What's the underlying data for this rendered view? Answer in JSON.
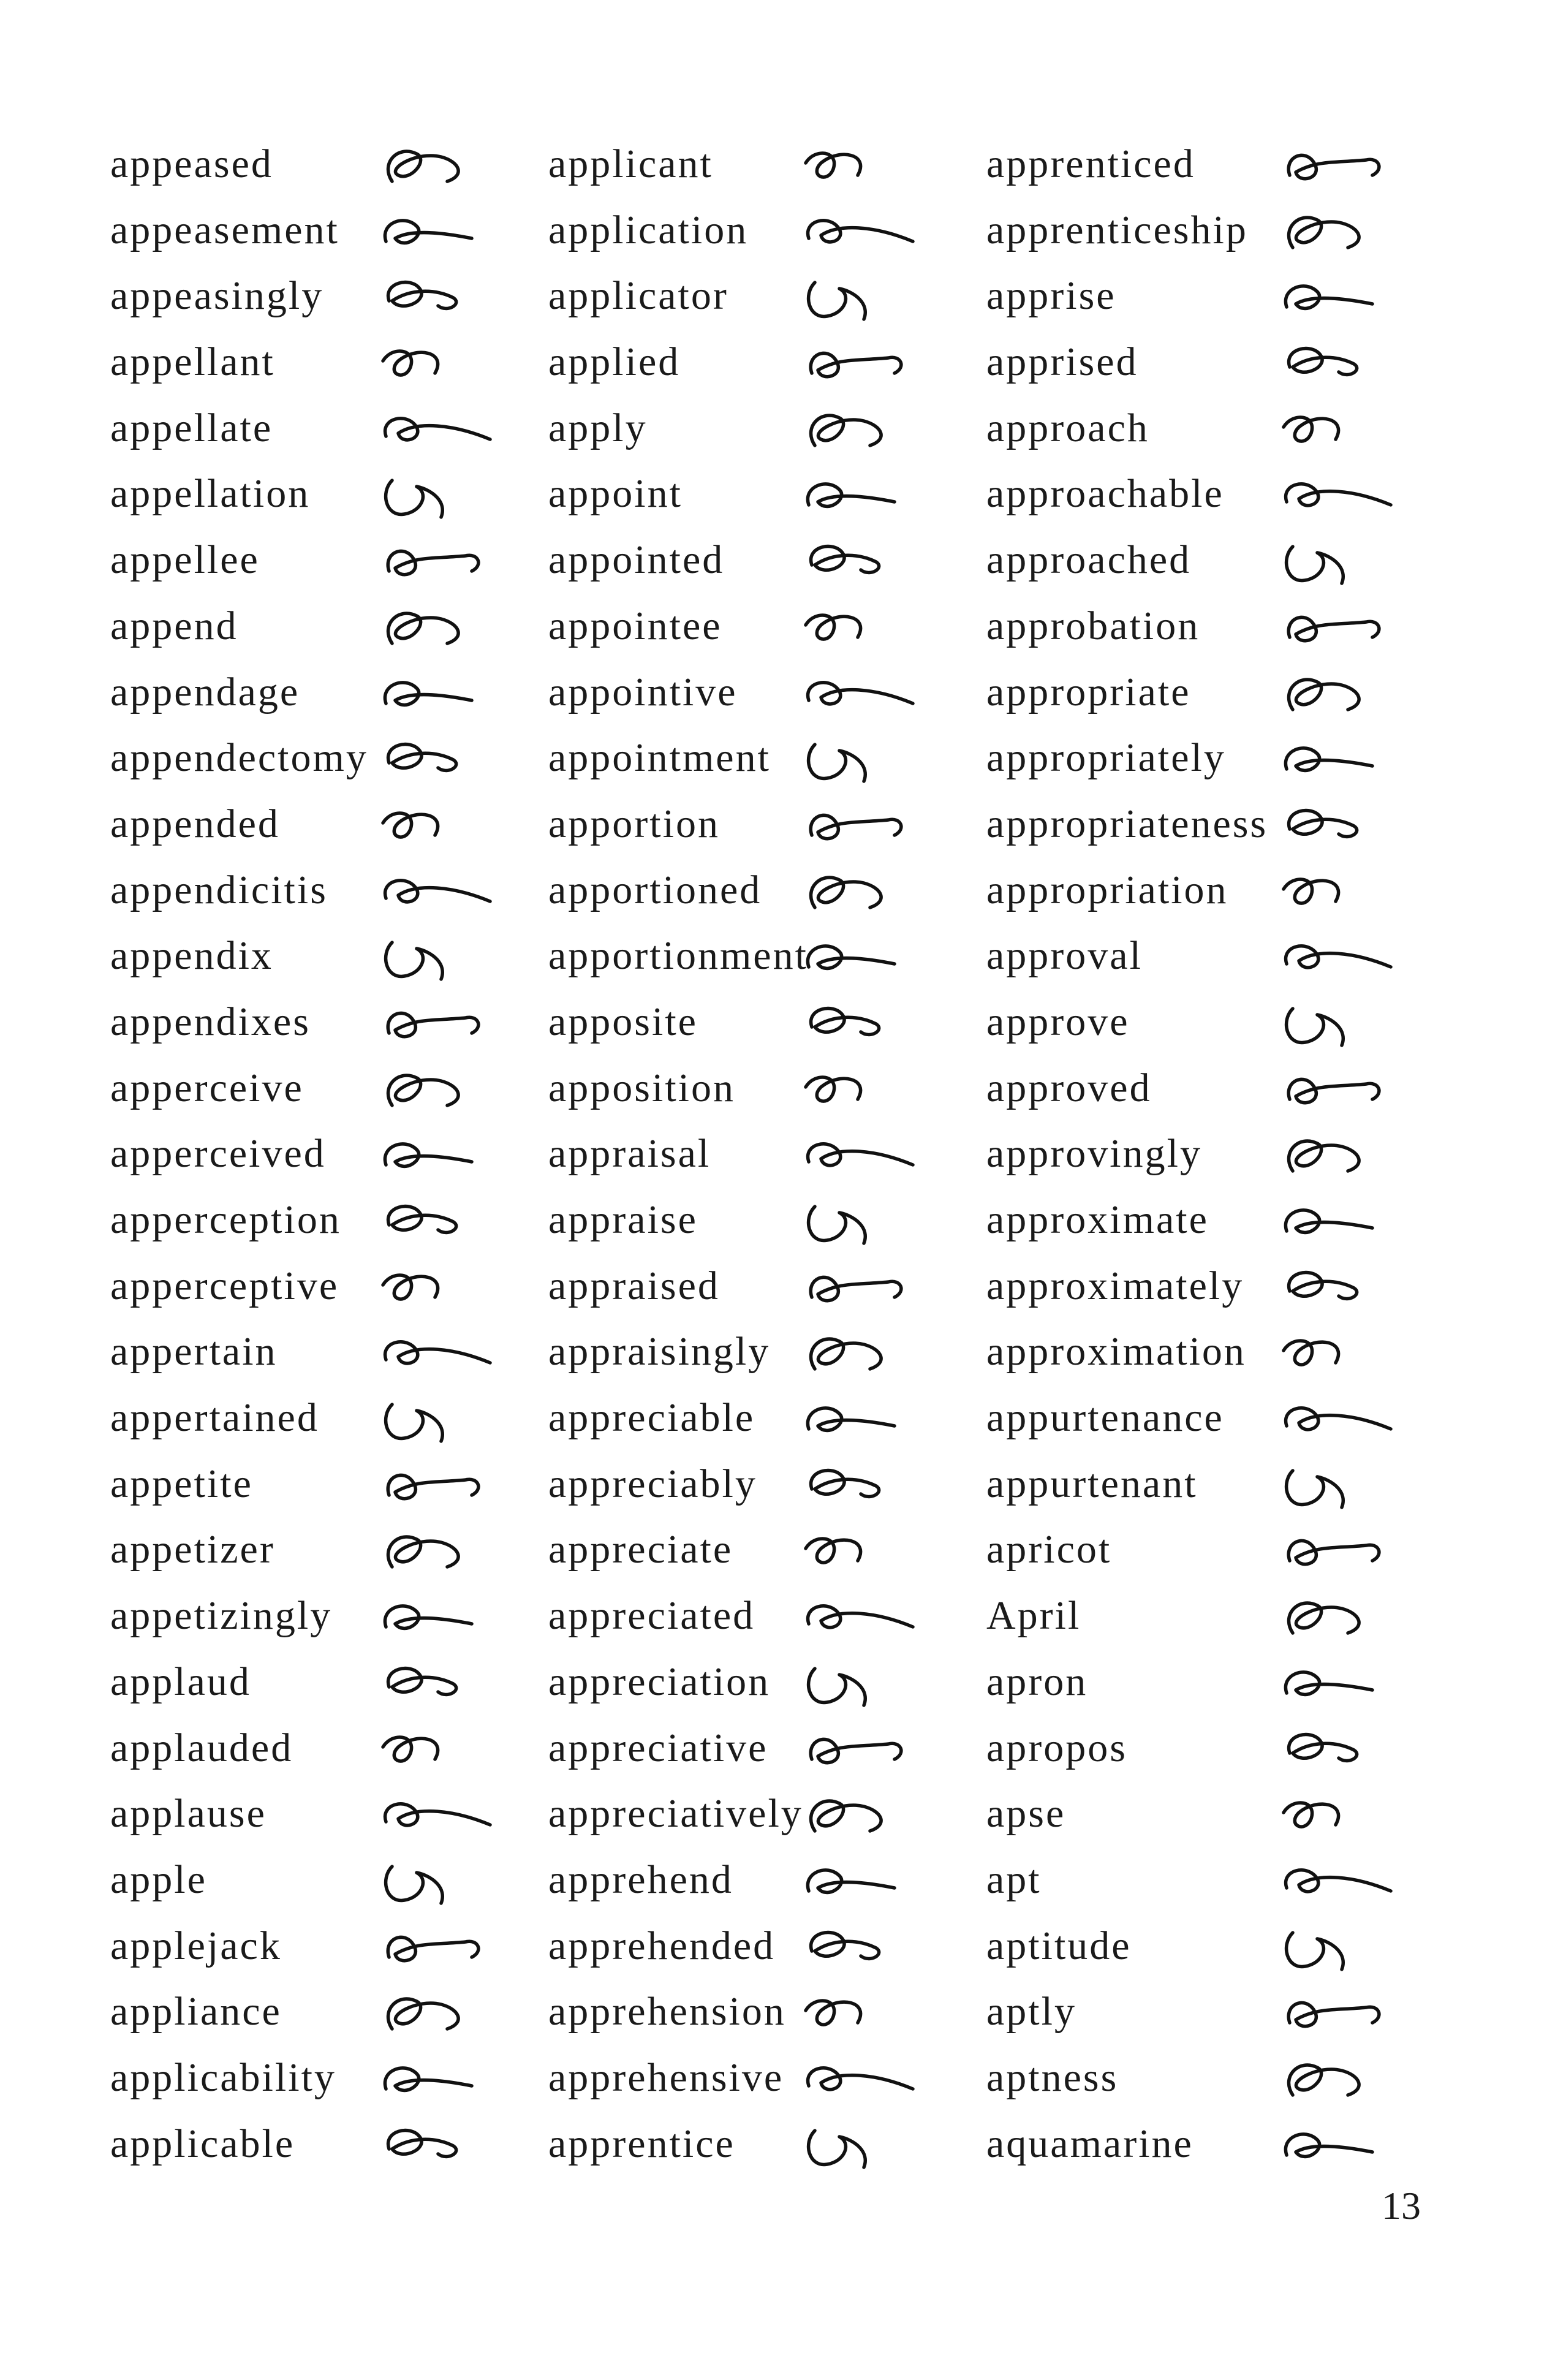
{
  "columns": [
    {
      "entries": [
        "appeased",
        "appeasement",
        "appeasingly",
        "appellant",
        "appellate",
        "appellation",
        "appellee",
        "append",
        "appendage",
        "appendectomy",
        "appended",
        "appendicitis",
        "appendix",
        "appendixes",
        "apperceive",
        "apperceived",
        "apperception",
        "apperceptive",
        "appertain",
        "appertained",
        "appetite",
        "appetizer",
        "appetizingly",
        "applaud",
        "applauded",
        "applause",
        "apple",
        "applejack",
        "appliance",
        "applicability",
        "applicable"
      ]
    },
    {
      "entries": [
        "applicant",
        "application",
        "applicator",
        "applied",
        "apply",
        "appoint",
        "appointed",
        "appointee",
        "appointive",
        "appointment",
        "apportion",
        "apportioned",
        "apportionment",
        "apposite",
        "apposition",
        "appraisal",
        "appraise",
        "appraised",
        "appraisingly",
        "appreciable",
        "appreciably",
        "appreciate",
        "appreciated",
        "appreciation",
        "appreciative",
        "appreciatively",
        "apprehend",
        "apprehended",
        "apprehension",
        "apprehensive",
        "apprentice"
      ]
    },
    {
      "entries": [
        "apprenticed",
        "apprenticeship",
        "apprise",
        "apprised",
        "approach",
        "approachable",
        "approached",
        "approbation",
        "appropriate",
        "appropriately",
        "appropriateness",
        "appropriation",
        "approval",
        "approve",
        "approved",
        "approvingly",
        "approximate",
        "approximately",
        "approximation",
        "appurtenance",
        "appurtenant",
        "apricot",
        "April",
        "apron",
        "apropos",
        "apse",
        "apt",
        "aptitude",
        "aptly",
        "aptness",
        "aquamarine"
      ]
    }
  ],
  "page_number": "13"
}
